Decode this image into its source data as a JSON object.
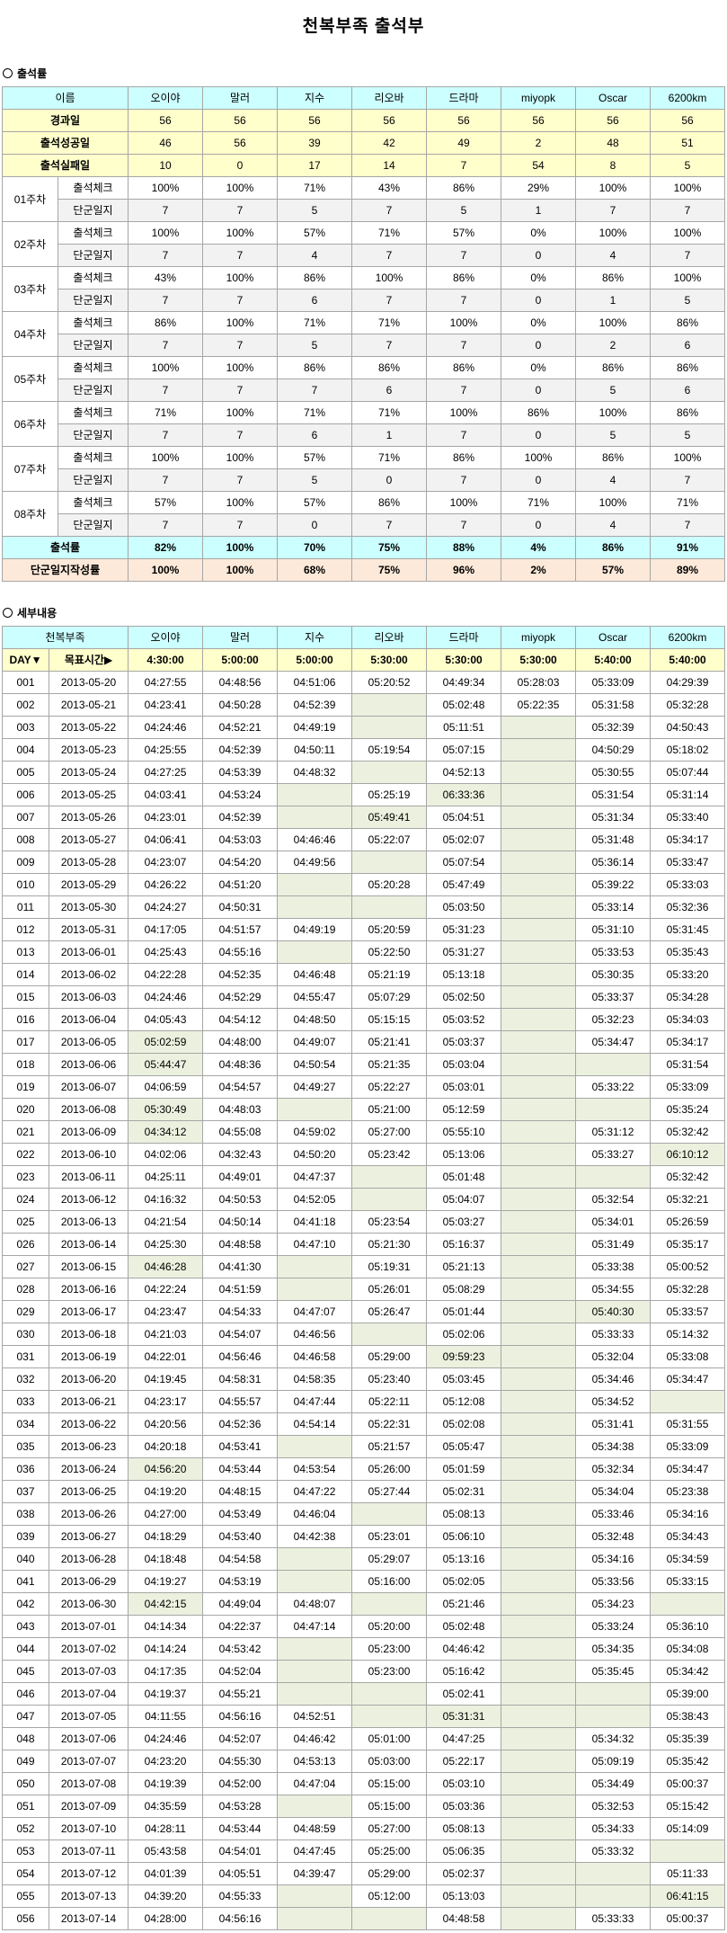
{
  "title": "천복부족 출석부",
  "bullet_icon": "circle-bullet-icon",
  "members": [
    "오이야",
    "말러",
    "지수",
    "리오바",
    "드라마",
    "miyopk",
    "Oscar",
    "6200km"
  ],
  "colors": {
    "header_bg": "#ccffff",
    "stat_bg": "#ffffcc",
    "log_bg": "#f2f2f2",
    "total_bg": "#ccffff",
    "rate_bg": "#fde9d9",
    "target_bg": "#ffffcc",
    "empty_bg": "#ebf1de",
    "flag_bg": "#ebf1de",
    "border": "#a6a6a6"
  },
  "summary": {
    "section_label": "출석률",
    "name_header": "이름",
    "check_label": "출석체크",
    "log_label": "단군일지",
    "stats": [
      {
        "label": "경과일",
        "values": [
          "56",
          "56",
          "56",
          "56",
          "56",
          "56",
          "56",
          "56"
        ]
      },
      {
        "label": "출석성공일",
        "values": [
          "46",
          "56",
          "39",
          "42",
          "49",
          "2",
          "48",
          "51"
        ]
      },
      {
        "label": "출석실패일",
        "values": [
          "10",
          "0",
          "17",
          "14",
          "7",
          "54",
          "8",
          "5"
        ]
      }
    ],
    "weeks": [
      {
        "week": "01주차",
        "check": [
          "100%",
          "100%",
          "71%",
          "43%",
          "86%",
          "29%",
          "100%",
          "100%"
        ],
        "log": [
          "7",
          "7",
          "5",
          "7",
          "5",
          "1",
          "7",
          "7"
        ]
      },
      {
        "week": "02주차",
        "check": [
          "100%",
          "100%",
          "57%",
          "71%",
          "57%",
          "0%",
          "100%",
          "100%"
        ],
        "log": [
          "7",
          "7",
          "4",
          "7",
          "7",
          "0",
          "4",
          "7"
        ]
      },
      {
        "week": "03주차",
        "check": [
          "43%",
          "100%",
          "86%",
          "100%",
          "86%",
          "0%",
          "86%",
          "100%"
        ],
        "log": [
          "7",
          "7",
          "6",
          "7",
          "7",
          "0",
          "1",
          "5"
        ]
      },
      {
        "week": "04주차",
        "check": [
          "86%",
          "100%",
          "71%",
          "71%",
          "100%",
          "0%",
          "100%",
          "86%"
        ],
        "log": [
          "7",
          "7",
          "5",
          "7",
          "7",
          "0",
          "2",
          "6"
        ]
      },
      {
        "week": "05주차",
        "check": [
          "100%",
          "100%",
          "86%",
          "86%",
          "86%",
          "0%",
          "86%",
          "86%"
        ],
        "log": [
          "7",
          "7",
          "7",
          "6",
          "7",
          "0",
          "5",
          "6"
        ]
      },
      {
        "week": "06주차",
        "check": [
          "71%",
          "100%",
          "71%",
          "71%",
          "100%",
          "86%",
          "100%",
          "86%"
        ],
        "log": [
          "7",
          "7",
          "6",
          "1",
          "7",
          "0",
          "5",
          "5"
        ]
      },
      {
        "week": "07주차",
        "check": [
          "100%",
          "100%",
          "57%",
          "71%",
          "86%",
          "100%",
          "86%",
          "100%"
        ],
        "log": [
          "7",
          "7",
          "5",
          "0",
          "7",
          "0",
          "4",
          "7"
        ]
      },
      {
        "week": "08주차",
        "check": [
          "57%",
          "100%",
          "57%",
          "86%",
          "100%",
          "71%",
          "100%",
          "71%"
        ],
        "log": [
          "7",
          "7",
          "0",
          "7",
          "7",
          "0",
          "4",
          "7"
        ]
      }
    ],
    "totals": [
      {
        "label": "출석률",
        "values": [
          "82%",
          "100%",
          "70%",
          "75%",
          "88%",
          "4%",
          "86%",
          "91%"
        ]
      },
      {
        "label": "단군일지작성률",
        "values": [
          "100%",
          "100%",
          "68%",
          "75%",
          "96%",
          "2%",
          "57%",
          "89%"
        ]
      }
    ]
  },
  "detail": {
    "section_label": "세부내용",
    "group_label": "천복부족",
    "day_label": "DAY▼",
    "target_label": "목표시간▶",
    "targets": [
      "4:30:00",
      "5:00:00",
      "5:00:00",
      "5:30:00",
      "5:30:00",
      "5:30:00",
      "5:40:00",
      "5:40:00"
    ],
    "rows": [
      {
        "day": "001",
        "date": "2013-05-20",
        "times": [
          "04:27:55",
          "04:48:56",
          "04:51:06",
          "05:20:52",
          "04:49:34",
          "05:28:03",
          "05:33:09",
          "04:29:39"
        ]
      },
      {
        "day": "002",
        "date": "2013-05-21",
        "times": [
          "04:23:41",
          "04:50:28",
          "04:52:39",
          "",
          "05:02:48",
          "05:22:35",
          "05:31:58",
          "05:32:28"
        ]
      },
      {
        "day": "003",
        "date": "2013-05-22",
        "times": [
          "04:24:46",
          "04:52:21",
          "04:49:19",
          "",
          "05:11:51",
          "",
          "05:32:39",
          "04:50:43"
        ]
      },
      {
        "day": "004",
        "date": "2013-05-23",
        "times": [
          "04:25:55",
          "04:52:39",
          "04:50:11",
          "05:19:54",
          "05:07:15",
          "",
          "04:50:29",
          "05:18:02"
        ]
      },
      {
        "day": "005",
        "date": "2013-05-24",
        "times": [
          "04:27:25",
          "04:53:39",
          "04:48:32",
          "",
          "04:52:13",
          "",
          "05:30:55",
          "05:07:44"
        ]
      },
      {
        "day": "006",
        "date": "2013-05-25",
        "times": [
          "04:03:41",
          "04:53:24",
          "",
          "05:25:19",
          "06:33:36",
          "",
          "05:31:54",
          "05:31:14"
        ],
        "flagged": [
          "드라마"
        ]
      },
      {
        "day": "007",
        "date": "2013-05-26",
        "times": [
          "04:23:01",
          "04:52:39",
          "",
          "05:49:41",
          "05:04:51",
          "",
          "05:31:34",
          "05:33:40"
        ],
        "flagged": [
          "리오바"
        ]
      },
      {
        "day": "008",
        "date": "2013-05-27",
        "times": [
          "04:06:41",
          "04:53:03",
          "04:46:46",
          "05:22:07",
          "05:02:07",
          "",
          "05:31:48",
          "05:34:17"
        ]
      },
      {
        "day": "009",
        "date": "2013-05-28",
        "times": [
          "04:23:07",
          "04:54:20",
          "04:49:56",
          "",
          "05:07:54",
          "",
          "05:36:14",
          "05:33:47"
        ]
      },
      {
        "day": "010",
        "date": "2013-05-29",
        "times": [
          "04:26:22",
          "04:51:20",
          "",
          "05:20:28",
          "05:47:49",
          "",
          "05:39:22",
          "05:33:03"
        ]
      },
      {
        "day": "011",
        "date": "2013-05-30",
        "times": [
          "04:24:27",
          "04:50:31",
          "",
          "",
          "05:03:50",
          "",
          "05:33:14",
          "05:32:36"
        ]
      },
      {
        "day": "012",
        "date": "2013-05-31",
        "times": [
          "04:17:05",
          "04:51:57",
          "04:49:19",
          "05:20:59",
          "05:31:23",
          "",
          "05:31:10",
          "05:31:45"
        ]
      },
      {
        "day": "013",
        "date": "2013-06-01",
        "times": [
          "04:25:43",
          "04:55:16",
          "",
          "05:22:50",
          "05:31:27",
          "",
          "05:33:53",
          "05:35:43"
        ]
      },
      {
        "day": "014",
        "date": "2013-06-02",
        "times": [
          "04:22:28",
          "04:52:35",
          "04:46:48",
          "05:21:19",
          "05:13:18",
          "",
          "05:30:35",
          "05:33:20"
        ]
      },
      {
        "day": "015",
        "date": "2013-06-03",
        "times": [
          "04:24:46",
          "04:52:29",
          "04:55:47",
          "05:07:29",
          "05:02:50",
          "",
          "05:33:37",
          "05:34:28"
        ]
      },
      {
        "day": "016",
        "date": "2013-06-04",
        "times": [
          "04:05:43",
          "04:54:12",
          "04:48:50",
          "05:15:15",
          "05:03:52",
          "",
          "05:32:23",
          "05:34:03"
        ]
      },
      {
        "day": "017",
        "date": "2013-06-05",
        "times": [
          "05:02:59",
          "04:48:00",
          "04:49:07",
          "05:21:41",
          "05:03:37",
          "",
          "05:34:47",
          "05:34:17"
        ],
        "flagged": [
          "오이야"
        ]
      },
      {
        "day": "018",
        "date": "2013-06-06",
        "times": [
          "05:44:47",
          "04:48:36",
          "04:50:54",
          "05:21:35",
          "05:03:04",
          "",
          "",
          "05:31:54"
        ],
        "flagged": [
          "오이야"
        ]
      },
      {
        "day": "019",
        "date": "2013-06-07",
        "times": [
          "04:06:59",
          "04:54:57",
          "04:49:27",
          "05:22:27",
          "05:03:01",
          "",
          "05:33:22",
          "05:33:09"
        ]
      },
      {
        "day": "020",
        "date": "2013-06-08",
        "times": [
          "05:30:49",
          "04:48:03",
          "",
          "05:21:00",
          "05:12:59",
          "",
          "",
          "05:35:24"
        ],
        "flagged": [
          "오이야"
        ]
      },
      {
        "day": "021",
        "date": "2013-06-09",
        "times": [
          "04:34:12",
          "04:55:08",
          "04:59:02",
          "05:27:00",
          "05:55:10",
          "",
          "05:31:12",
          "05:32:42"
        ],
        "flagged": [
          "오이야"
        ]
      },
      {
        "day": "022",
        "date": "2013-06-10",
        "times": [
          "04:02:06",
          "04:32:43",
          "04:50:20",
          "05:23:42",
          "05:13:06",
          "",
          "05:33:27",
          "06:10:12"
        ],
        "flagged": [
          "6200km"
        ]
      },
      {
        "day": "023",
        "date": "2013-06-11",
        "times": [
          "04:25:11",
          "04:49:01",
          "04:47:37",
          "",
          "05:01:48",
          "",
          "",
          "05:32:42"
        ]
      },
      {
        "day": "024",
        "date": "2013-06-12",
        "times": [
          "04:16:32",
          "04:50:53",
          "04:52:05",
          "",
          "05:04:07",
          "",
          "05:32:54",
          "05:32:21"
        ]
      },
      {
        "day": "025",
        "date": "2013-06-13",
        "times": [
          "04:21:54",
          "04:50:14",
          "04:41:18",
          "05:23:54",
          "05:03:27",
          "",
          "05:34:01",
          "05:26:59"
        ]
      },
      {
        "day": "026",
        "date": "2013-06-14",
        "times": [
          "04:25:30",
          "04:48:58",
          "04:47:10",
          "05:21:30",
          "05:16:37",
          "",
          "05:31:49",
          "05:35:17"
        ]
      },
      {
        "day": "027",
        "date": "2013-06-15",
        "times": [
          "04:46:28",
          "04:41:30",
          "",
          "05:19:31",
          "05:21:13",
          "",
          "05:33:38",
          "05:00:52"
        ],
        "flagged": [
          "오이야"
        ]
      },
      {
        "day": "028",
        "date": "2013-06-16",
        "times": [
          "04:22:24",
          "04:51:59",
          "",
          "05:26:01",
          "05:08:29",
          "",
          "05:34:55",
          "05:32:28"
        ]
      },
      {
        "day": "029",
        "date": "2013-06-17",
        "times": [
          "04:23:47",
          "04:54:33",
          "04:47:07",
          "05:26:47",
          "05:01:44",
          "",
          "05:40:30",
          "05:33:57"
        ],
        "flagged": [
          "Oscar"
        ]
      },
      {
        "day": "030",
        "date": "2013-06-18",
        "times": [
          "04:21:03",
          "04:54:07",
          "04:46:56",
          "",
          "05:02:06",
          "",
          "05:33:33",
          "05:14:32"
        ]
      },
      {
        "day": "031",
        "date": "2013-06-19",
        "times": [
          "04:22:01",
          "04:56:46",
          "04:46:58",
          "05:29:00",
          "09:59:23",
          "",
          "05:32:04",
          "05:33:08"
        ],
        "flagged": [
          "드라마"
        ]
      },
      {
        "day": "032",
        "date": "2013-06-20",
        "times": [
          "04:19:45",
          "04:58:31",
          "04:58:35",
          "05:23:40",
          "05:03:45",
          "",
          "05:34:46",
          "05:34:47"
        ]
      },
      {
        "day": "033",
        "date": "2013-06-21",
        "times": [
          "04:23:17",
          "04:55:57",
          "04:47:44",
          "05:22:11",
          "05:12:08",
          "",
          "05:34:52",
          ""
        ]
      },
      {
        "day": "034",
        "date": "2013-06-22",
        "times": [
          "04:20:56",
          "04:52:36",
          "04:54:14",
          "05:22:31",
          "05:02:08",
          "",
          "05:31:41",
          "05:31:55"
        ]
      },
      {
        "day": "035",
        "date": "2013-06-23",
        "times": [
          "04:20:18",
          "04:53:41",
          "",
          "05:21:57",
          "05:05:47",
          "",
          "05:34:38",
          "05:33:09"
        ]
      },
      {
        "day": "036",
        "date": "2013-06-24",
        "times": [
          "04:56:20",
          "04:53:44",
          "04:53:54",
          "05:26:00",
          "05:01:59",
          "",
          "05:32:34",
          "05:34:47"
        ],
        "flagged": [
          "오이야"
        ]
      },
      {
        "day": "037",
        "date": "2013-06-25",
        "times": [
          "04:19:20",
          "04:48:15",
          "04:47:22",
          "05:27:44",
          "05:02:31",
          "",
          "05:34:04",
          "05:23:38"
        ]
      },
      {
        "day": "038",
        "date": "2013-06-26",
        "times": [
          "04:27:00",
          "04:53:49",
          "04:46:04",
          "",
          "05:08:13",
          "",
          "05:33:46",
          "05:34:16"
        ]
      },
      {
        "day": "039",
        "date": "2013-06-27",
        "times": [
          "04:18:29",
          "04:53:40",
          "04:42:38",
          "05:23:01",
          "05:06:10",
          "",
          "05:32:48",
          "05:34:43"
        ]
      },
      {
        "day": "040",
        "date": "2013-06-28",
        "times": [
          "04:18:48",
          "04:54:58",
          "",
          "05:29:07",
          "05:13:16",
          "",
          "05:34:16",
          "05:34:59"
        ]
      },
      {
        "day": "041",
        "date": "2013-06-29",
        "times": [
          "04:19:27",
          "04:53:19",
          "",
          "05:16:00",
          "05:02:05",
          "",
          "05:33:56",
          "05:33:15"
        ]
      },
      {
        "day": "042",
        "date": "2013-06-30",
        "times": [
          "04:42:15",
          "04:49:04",
          "04:48:07",
          "",
          "05:21:46",
          "",
          "05:34:23",
          ""
        ],
        "flagged": [
          "오이야"
        ]
      },
      {
        "day": "043",
        "date": "2013-07-01",
        "times": [
          "04:14:34",
          "04:22:37",
          "04:47:14",
          "05:20:00",
          "05:02:48",
          "",
          "05:33:24",
          "05:36:10"
        ]
      },
      {
        "day": "044",
        "date": "2013-07-02",
        "times": [
          "04:14:24",
          "04:53:42",
          "",
          "05:23:00",
          "04:46:42",
          "",
          "05:34:35",
          "05:34:08"
        ]
      },
      {
        "day": "045",
        "date": "2013-07-03",
        "times": [
          "04:17:35",
          "04:52:04",
          "",
          "05:23:00",
          "05:16:42",
          "",
          "05:35:45",
          "05:34:42"
        ]
      },
      {
        "day": "046",
        "date": "2013-07-04",
        "times": [
          "04:19:37",
          "04:55:21",
          "",
          "",
          "05:02:41",
          "",
          "",
          "05:39:00"
        ]
      },
      {
        "day": "047",
        "date": "2013-07-05",
        "times": [
          "04:11:55",
          "04:56:16",
          "04:52:51",
          "",
          "05:31:31",
          "",
          "",
          "05:38:43"
        ],
        "flagged": [
          "드라마"
        ]
      },
      {
        "day": "048",
        "date": "2013-07-06",
        "times": [
          "04:24:46",
          "04:52:07",
          "04:46:42",
          "05:01:00",
          "04:47:25",
          "",
          "05:34:32",
          "05:35:39"
        ]
      },
      {
        "day": "049",
        "date": "2013-07-07",
        "times": [
          "04:23:20",
          "04:55:30",
          "04:53:13",
          "05:03:00",
          "05:22:17",
          "",
          "05:09:19",
          "05:35:42"
        ]
      },
      {
        "day": "050",
        "date": "2013-07-08",
        "times": [
          "04:19:39",
          "04:52:00",
          "04:47:04",
          "05:15:00",
          "05:03:10",
          "",
          "05:34:49",
          "05:00:37"
        ]
      },
      {
        "day": "051",
        "date": "2013-07-09",
        "times": [
          "04:35:59",
          "04:53:28",
          "",
          "05:15:00",
          "05:03:36",
          "",
          "05:32:53",
          "05:15:42"
        ]
      },
      {
        "day": "052",
        "date": "2013-07-10",
        "times": [
          "04:28:11",
          "04:53:44",
          "04:48:59",
          "05:27:00",
          "05:08:13",
          "",
          "05:34:33",
          "05:14:09"
        ]
      },
      {
        "day": "053",
        "date": "2013-07-11",
        "times": [
          "05:43:58",
          "04:54:01",
          "04:47:45",
          "05:25:00",
          "05:06:35",
          "",
          "05:33:32",
          ""
        ]
      },
      {
        "day": "054",
        "date": "2013-07-12",
        "times": [
          "04:01:39",
          "04:05:51",
          "04:39:47",
          "05:29:00",
          "05:02:37",
          "",
          "",
          "05:11:33"
        ]
      },
      {
        "day": "055",
        "date": "2013-07-13",
        "times": [
          "04:39:20",
          "04:55:33",
          "",
          "05:12:00",
          "05:13:03",
          "",
          "",
          "06:41:15"
        ],
        "flagged": [
          "6200km"
        ]
      },
      {
        "day": "056",
        "date": "2013-07-14",
        "times": [
          "04:28:00",
          "04:56:16",
          "",
          "",
          "04:48:58",
          "",
          "05:33:33",
          "05:00:37"
        ]
      }
    ]
  }
}
